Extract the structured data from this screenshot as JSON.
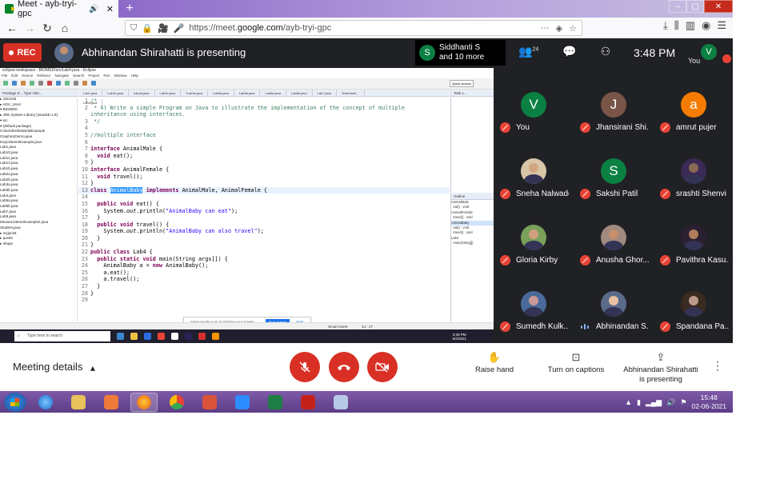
{
  "browser": {
    "tab_title": "Meet - ayb-tryi-gpc",
    "url_prefix": "https://meet.",
    "url_domain": "google.com",
    "url_path": "/ayb-tryi-gpc",
    "url_dots": "···"
  },
  "meet": {
    "rec_label": "REC",
    "presenting_text": "Abhinandan Shirahatti is presenting",
    "join_chip_avatar": "S",
    "join_chip_line1": "Siddhanti S",
    "join_chip_line2": "and 10 more",
    "people_count": "24",
    "time": "3:48  PM",
    "self_avatar": "V",
    "self_label": "You"
  },
  "eclipse": {
    "title": "eclipse-workspace - BIOMED/src/Lab4.java - Eclipse",
    "menu": [
      "File",
      "Edit",
      "Source",
      "Refactor",
      "Navigate",
      "Search",
      "Project",
      "Run",
      "Window",
      "Help"
    ],
    "quick_access": "Quick Access",
    "package_head": "Package E...  Type Hier...",
    "tree": [
      "▸ 18CS45",
      "▸ ADV_JAVA",
      "▾ BIOMED",
      "   ▸ JRE System Library [JavaSE-1.8]",
      "   ▾ src",
      "      ▾ (default package)",
      "         ColoredHelloWorldExample",
      "         GraphicsDemo.java",
      "         KeyListenerExample.java",
      "         Lab1.java",
      "         Lab10.java",
      "         Lab11.java",
      "         Lab12.java",
      "         Lab1b.java",
      "         Lab2a.java",
      "         Lab2b.java",
      "         Lab3a.java",
      "         Lab3b.java",
      "         Lab4.java",
      "         Lab5a.java",
      "         Lab5b.java",
      "         Lab7.java",
      "         Lab8.java",
      "         MouseListenerExample2.java",
      "         Student.java",
      "▸ myjack6",
      "▸ pack6",
      "▸ shape"
    ],
    "editor_tabs": [
      "Lab1.java",
      "Lab1b.java",
      "Lab2a.java",
      "Lab2b.java",
      "*Lab3a.java",
      "Lab4.java",
      "Lab5a.java",
      "Lab5b.java",
      "Lab6a.java",
      "Lab6b.java",
      "Lab7.java",
      "TestInherit..."
    ],
    "outline_head": "Outline",
    "outline_items": [
      "AnimalMale",
      "  eat() : void",
      "AnimalFemale",
      "  travel() : void",
      "AnimalBaby",
      "  eat() : void",
      "  travel() : void",
      "Lab4",
      "  main(String[])"
    ],
    "task_head": "Task L...",
    "share_notice": "meet.google.com is sharing your screen.",
    "stop_sharing": "Stop sharing",
    "hide": "Hide",
    "status_insert": "Smart Insert",
    "status_pos": "14 : 17",
    "search_placeholder": "Type here to search",
    "inner_time": "3:48 PM",
    "inner_date": "6/2/2021"
  },
  "participants": [
    {
      "name": "You",
      "avatar": "V",
      "color": "#0b8043",
      "photo": false
    },
    {
      "name": "Jhansirani Shi...",
      "avatar": "J",
      "color": "#795548",
      "photo": false
    },
    {
      "name": "amrut pujer",
      "avatar": "a",
      "color": "#f57c00",
      "photo": false
    },
    {
      "name": "Sneha Nalwade",
      "avatar": "",
      "color": "#d9c6a8",
      "photo": true
    },
    {
      "name": "Sakshi Patil",
      "avatar": "S",
      "color": "#0b8043",
      "photo": false
    },
    {
      "name": "srashti Shenvi",
      "avatar": "",
      "color": "#3b2a55",
      "photo": true
    },
    {
      "name": "Gloria Kirby",
      "avatar": "",
      "color": "#7aa05a",
      "photo": true
    },
    {
      "name": "Anusha Ghor...",
      "avatar": "",
      "color": "#a08a80",
      "photo": true
    },
    {
      "name": "Pavithra Kasu...",
      "avatar": "",
      "color": "#2a2030",
      "photo": true
    },
    {
      "name": "Sumedh Kulk...",
      "avatar": "",
      "color": "#4a6a9a",
      "photo": true
    },
    {
      "name": "Abhinandan S...",
      "avatar": "",
      "color": "#5a6b8a",
      "photo": true
    },
    {
      "name": "Spandana Pa...",
      "avatar": "",
      "color": "#3a2a20",
      "photo": true
    }
  ],
  "bottom": {
    "meeting_details": "Meeting details",
    "raise_hand": "Raise hand",
    "captions": "Turn on captions",
    "presenting_line1": "Abhinandan Shirahatti",
    "presenting_line2": "is presenting"
  },
  "taskbar": {
    "time": "15:48",
    "date": "02-06-2021"
  },
  "colors": {
    "rec": "#d93025",
    "meet_bg": "#202124",
    "muted": "#ea4335",
    "taskbar": "#6b4a96"
  }
}
